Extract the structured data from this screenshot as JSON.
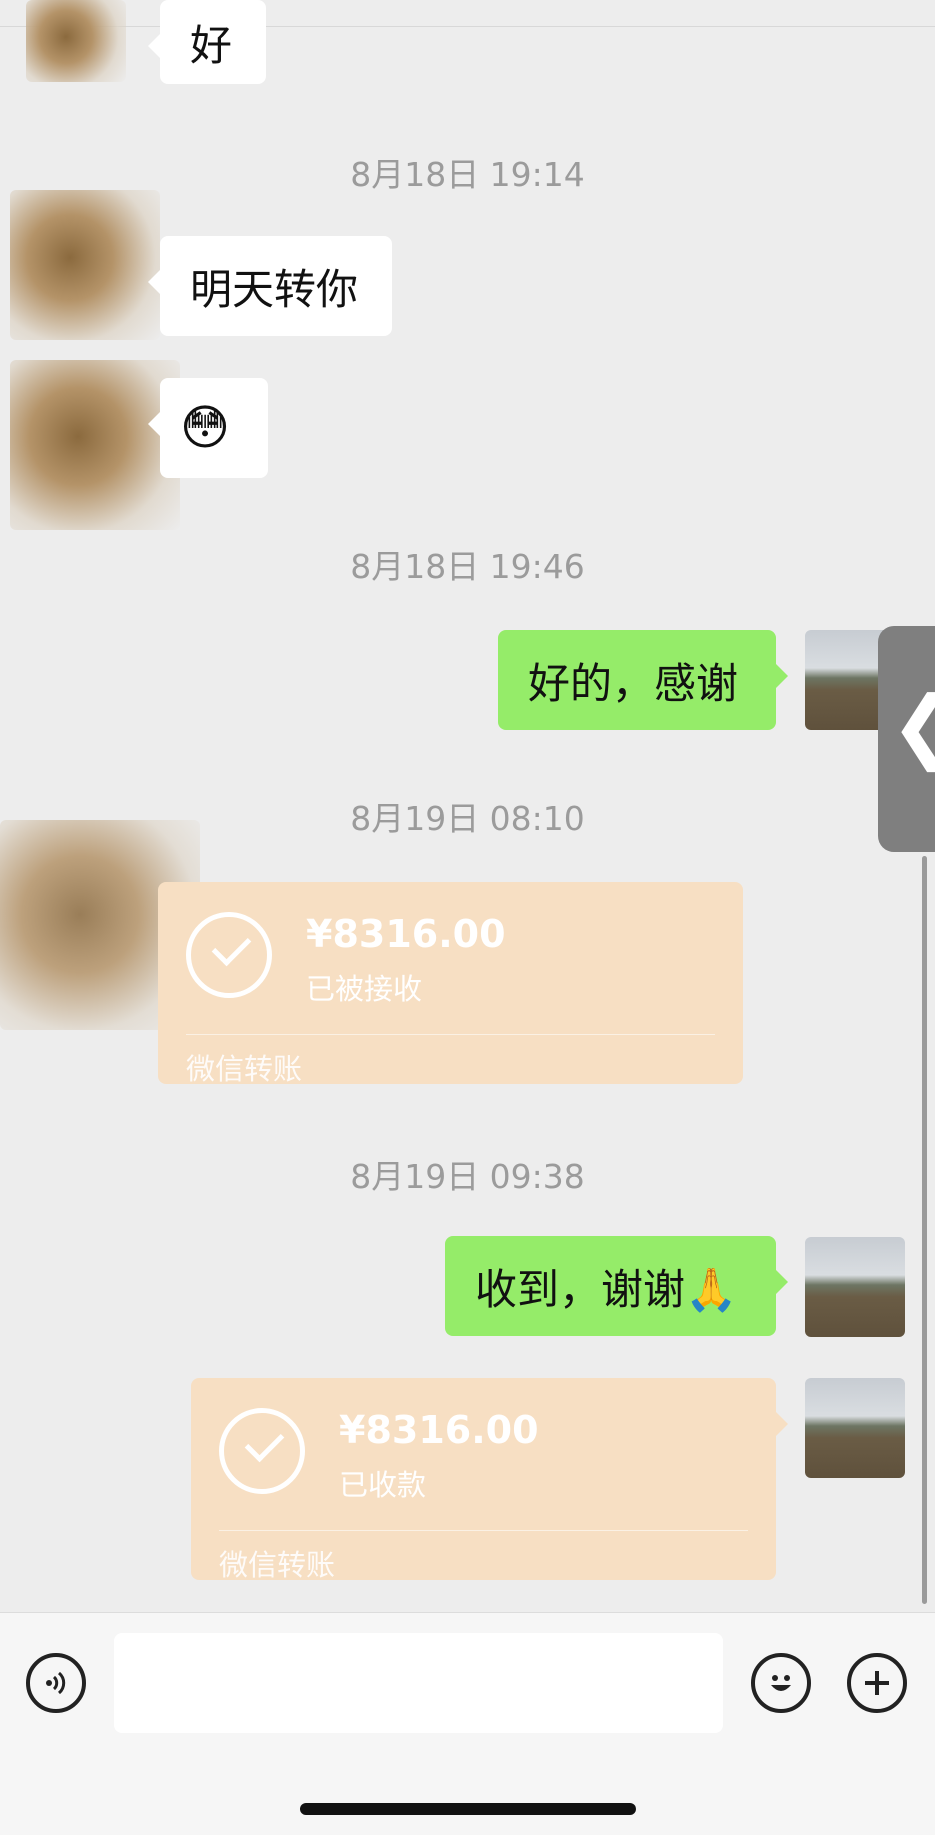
{
  "messages": {
    "top_partial": "好",
    "ts1": "8月18日 19:14",
    "m1": "明天转你",
    "m2_emoji": "😳",
    "ts2": "8月18日 19:46",
    "m3": "好的，感谢",
    "ts3": "8月19日 08:10",
    "transfer1": {
      "amount": "¥8316.00",
      "status": "已被接收",
      "footer": "微信转账"
    },
    "ts4": "8月19日 09:38",
    "m4": "收到，谢谢🙏",
    "transfer2": {
      "amount": "¥8316.00",
      "status": "已收款",
      "footer": "微信转账"
    }
  },
  "side_handle": {
    "glyph": "❮"
  },
  "input_bar": {
    "voice_icon": "voice-icon",
    "emoji_icon": "emoji-icon",
    "plus_icon": "plus-icon"
  },
  "colors": {
    "bg": "#ededed",
    "green_bubble": "#95ec69",
    "transfer_bubble": "#f7dfc3",
    "timestamp": "#9b9b9b"
  }
}
